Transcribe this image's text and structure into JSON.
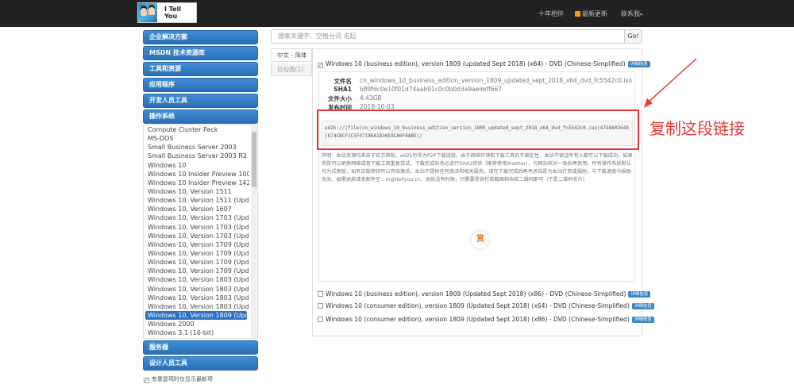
{
  "header": {
    "logo_text": "I Tell You",
    "nav": [
      "十年相伴",
      "最新更新",
      "联系我"
    ]
  },
  "sidebar": {
    "categories_top": [
      "企业解决方案",
      "MSDN 技术资源库",
      "工具和资源",
      "应用程序",
      "开发人员工具",
      "操作系统"
    ],
    "os_items": [
      "Compute Cluster Pack",
      "MS-DOS",
      "Small Business Server 2003",
      "Small Business Server 2003 R2",
      "Windows 10",
      "Windows 10 Insider Preview 10074",
      "Windows 10 Insider Preview 14295",
      "Windows 10, Version 1511",
      "Windows 10, Version 1511 (Upda",
      "Windows 10, Version 1607",
      "Windows 10, Version 1703 (Upda",
      "Windows 10, Version 1703 (Upda",
      "Windows 10, Version 1703 (Upda",
      "Windows 10, Version 1709 (Upda",
      "Windows 10, Version 1709 (Upda",
      "Windows 10, Version 1709 (Upda",
      "Windows 10, Version 1709 (Upda",
      "Windows 10, Version 1803 (Upda",
      "Windows 10, Version 1803 (Upda",
      "Windows 10, Version 1803 (Upda",
      "Windows 10, Version 1803 (Upda",
      "Windows 10, Version 1809 (Upd...",
      "Windows 2000",
      "Windows 3.1 (16-bit)"
    ],
    "active_index": 21,
    "categories_bottom": [
      "服务器",
      "设计人员工具"
    ],
    "checkbox_label": "有重复项时仅显示最新项",
    "checkbox_mark": "✓"
  },
  "search": {
    "placeholder": "搜索关键字、空格分词 走起",
    "go_label": "Go!"
  },
  "tabs": [
    "中文 - 简体",
    "已勾选(1)"
  ],
  "downloads": {
    "tag_label": "详细信息",
    "items": [
      "Windows 10 (business edition), version 1809 (updated Sept 2018) (x64) - DVD (Chinese-Simplified)",
      "Windows 10 (business edition), version 1809 (Updated Sept 2018) (x86) - DVD (Chinese-Simplified)",
      "Windows 10 (consumer edition), version 1809 (Updated Sept 2018) (x64) - DVD (Chinese-Simplified)",
      "Windows 10 (consumer edition), version 1809 (Updated Sept 2018) (x86) - DVD (Chinese-Simplified)"
    ],
    "first_checked_mark": "✓"
  },
  "detail": {
    "labels": [
      "文件名",
      "SHA1",
      "文件大小",
      "发布时间"
    ],
    "values": [
      "cn_windows_10_business_edition_version_1809_updated_sept_2018_x64_dvd_fc5542c0.iso",
      "b89fdc0e10f01d74aab91c0c0b0d3a9aedeff667",
      "4.43GB",
      "2018-10-03"
    ],
    "ed2k": "ed2k://|file|cn_windows_10_business_edition_version_1809_updated_sept_2018_x64_dvd_fc5542c0.iso|4758603648|874CBCF3C5F0719EA1830E9CA0F4ABE|/",
    "notice": "声明：本站资源均来自于官方原版，ed2k可视为P2P下载链接，由于网络环境和下载工具的不确定性，本站不保证所有人都可以下载成功。如果失败可以更换网络或者下载工具重复尝试，下载完成后务必进行SHA1校验（推荐使用iHasher），与网站核对一致后再使用。所有操作系统默认均为试用版，如有正版密钥可以有效激活，本站不提供任何激活和相关服务。请在下载完成后再考虑自愿为本站打赏或捐助，与下载速度与捐助无关。如需退款请发邮件至：m@itellyou.cn，退款没有时限，只需要提供打款截图和收款二维码即可（不是二维码名片）",
    "reward_label": "赏"
  },
  "annotation": {
    "text": "复制这段链接",
    "color": "#e53935"
  }
}
